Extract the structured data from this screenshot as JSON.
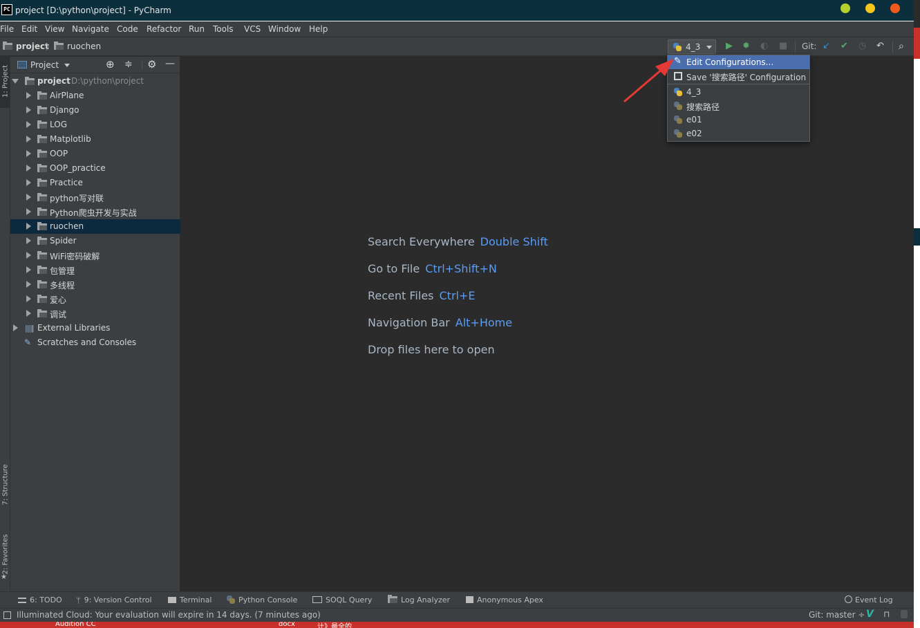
{
  "window": {
    "title": "project [D:\\python\\project] - PyCharm",
    "logo_text": "PC",
    "dot_colors": [
      "#b6d22e",
      "#f4c61c",
      "#f25a1d"
    ]
  },
  "menu": [
    "File",
    "Edit",
    "View",
    "Navigate",
    "Code",
    "Refactor",
    "Run",
    "Tools",
    "VCS",
    "Window",
    "Help"
  ],
  "breadcrumb": {
    "root": "project",
    "child": "ruochen"
  },
  "toolbar": {
    "run_config": "4_3",
    "git_label": "Git:"
  },
  "run_popup": {
    "items": [
      {
        "label": "Edit Configurations...",
        "icon": "pencil-icon"
      },
      {
        "label": "Save '搜索路径' Configuration",
        "icon": "save-icon"
      },
      {
        "label": "4_3",
        "icon": "python-icon"
      },
      {
        "label": "搜索路径",
        "icon": "python-icon"
      },
      {
        "label": "e01",
        "icon": "python-icon"
      },
      {
        "label": "e02",
        "icon": "python-icon"
      }
    ]
  },
  "side_tabs": {
    "project": "1: Project",
    "structure": "7: Structure",
    "favorites": "2: Favorites"
  },
  "project_panel": {
    "title": "Project",
    "root": {
      "name": "project",
      "path": "D:\\python\\project"
    },
    "folders": [
      "AirPlane",
      "Django",
      "LOG",
      "Matplotlib",
      "OOP",
      "OOP_practice",
      "Practice",
      "python写对联",
      "Python爬虫开发与实战",
      "ruochen",
      "Spider",
      "WiFi密码破解",
      "包管理",
      "多线程",
      "爱心",
      "调试"
    ],
    "selected": "ruochen",
    "extra": [
      "External Libraries",
      "Scratches and Consoles"
    ]
  },
  "editor_hints": [
    {
      "text": "Search Everywhere",
      "key": "Double Shift"
    },
    {
      "text": "Go to File",
      "key": "Ctrl+Shift+N"
    },
    {
      "text": "Recent Files",
      "key": "Ctrl+E"
    },
    {
      "text": "Navigation Bar",
      "key": "Alt+Home"
    },
    {
      "text": "Drop files here to open",
      "key": ""
    }
  ],
  "bottom_tabs": [
    {
      "label": "6: TODO"
    },
    {
      "label": "9: Version Control"
    },
    {
      "label": "Terminal"
    },
    {
      "label": "Python Console"
    },
    {
      "label": "SOQL Query"
    },
    {
      "label": "Log Analyzer"
    },
    {
      "label": "Anonymous Apex"
    },
    {
      "label": "Event Log"
    }
  ],
  "status": {
    "message": "Illuminated Cloud: Your evaluation will expire in 14 days. (7 minutes ago)",
    "git_branch": "Git: master ÷"
  },
  "taskbar": [
    "Audition CC",
    "docx",
    "计》最全的"
  ],
  "accent": "#589df6",
  "selection_color": "#4b6eaf"
}
